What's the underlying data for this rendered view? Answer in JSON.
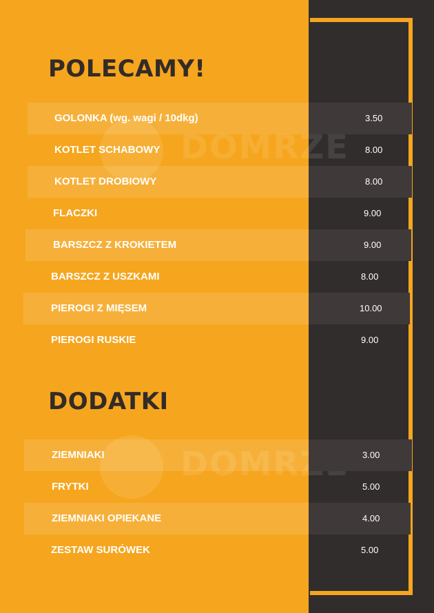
{
  "sections": [
    {
      "title": "POLECAMY!",
      "items": [
        {
          "name": "GOLONKA (wg. wagi / 10dkg)",
          "price": "3.50"
        },
        {
          "name": "KOTLET SCHABOWY",
          "price": "8.00"
        },
        {
          "name": "KOTLET DROBIOWY",
          "price": "8.00"
        },
        {
          "name": "FLACZKI",
          "price": "9.00"
        },
        {
          "name": "BARSZCZ Z KROKIETEM",
          "price": "9.00"
        },
        {
          "name": "BARSZCZ Z USZKAMI",
          "price": "8.00"
        },
        {
          "name": "PIEROGI Z MIĘSEM",
          "price": "10.00"
        },
        {
          "name": "PIEROGI RUSKIE",
          "price": "9.00"
        }
      ]
    },
    {
      "title": "DODATKI",
      "items": [
        {
          "name": "ZIEMNIAKI",
          "price": "3.00"
        },
        {
          "name": "FRYTKI",
          "price": "5.00"
        },
        {
          "name": "ZIEMNIAKI OPIEKANE",
          "price": "4.00"
        },
        {
          "name": "ZESTAW SURÓWEK",
          "price": "5.00"
        }
      ]
    }
  ],
  "watermark": "DOMRZE",
  "colors": {
    "accent": "#f5a61e",
    "dark": "#322d2d",
    "heading": "#332b28"
  }
}
